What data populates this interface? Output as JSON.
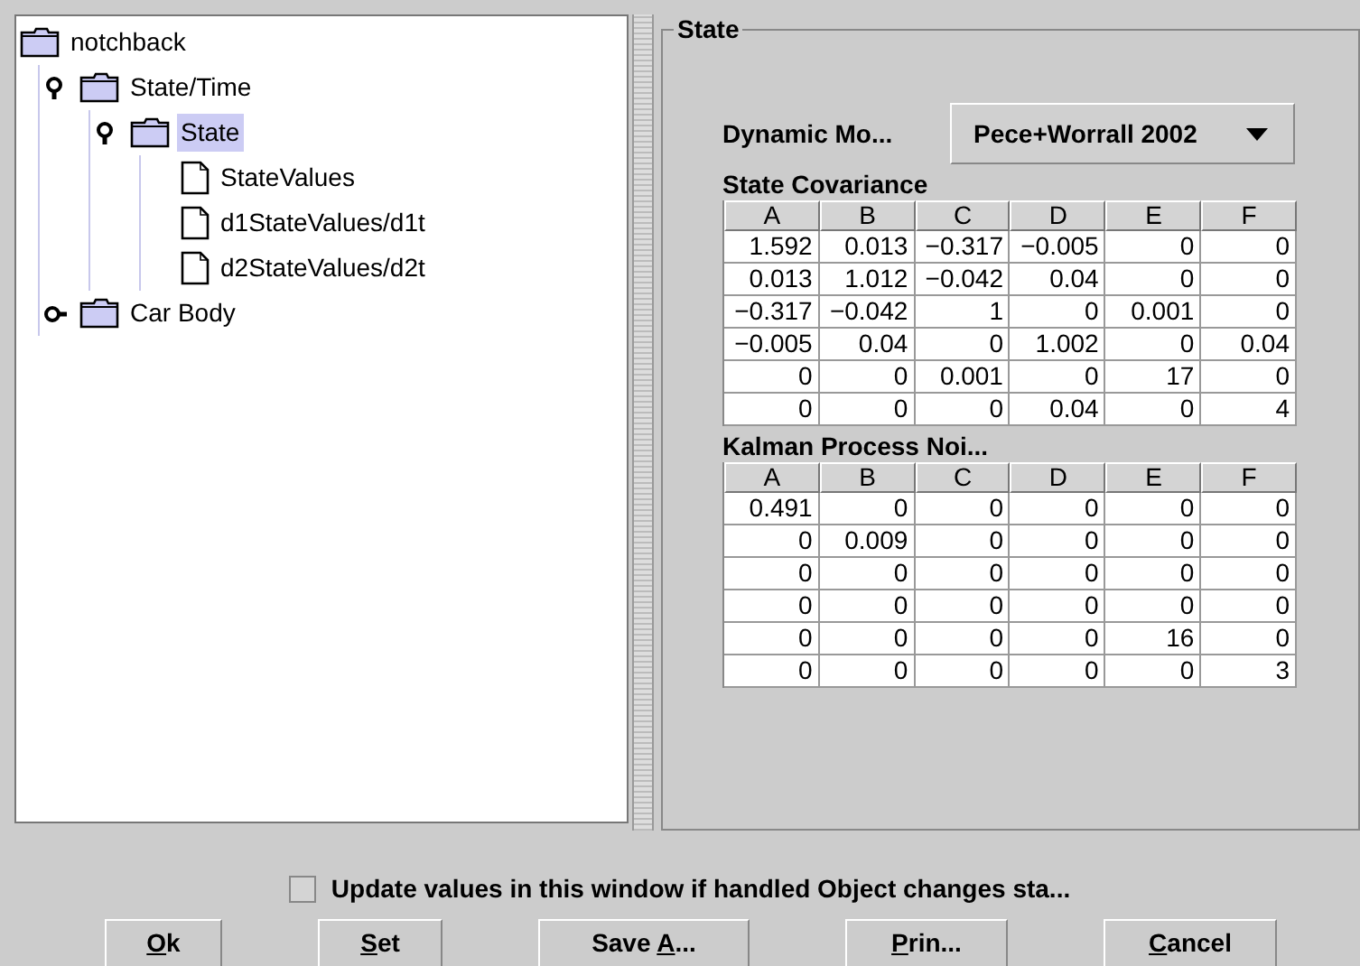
{
  "tree": {
    "root": {
      "label": "notchback",
      "selected": false,
      "children": [
        {
          "kind": "folder",
          "label": "State/Time",
          "expanded": true,
          "selected": false,
          "children": [
            {
              "kind": "folder",
              "label": "State",
              "expanded": true,
              "selected": true,
              "children": [
                {
                  "kind": "file",
                  "label": "StateValues",
                  "selected": false
                },
                {
                  "kind": "file",
                  "label": "d1StateValues/d1t",
                  "selected": false
                },
                {
                  "kind": "file",
                  "label": "d2StateValues/d2t",
                  "selected": false
                }
              ]
            }
          ]
        },
        {
          "kind": "folder",
          "label": "Car Body",
          "expanded": false,
          "selected": false
        }
      ]
    }
  },
  "group": {
    "title": "State",
    "dynamic_model": {
      "label": "Dynamic Mo...",
      "value": "Pece+Worrall 2002"
    },
    "tables": [
      {
        "title": "State Covariance",
        "columns": [
          "A",
          "B",
          "C",
          "D",
          "E",
          "F"
        ],
        "rows": [
          [
            "1.592",
            "0.013",
            "−0.317",
            "−0.005",
            "0",
            "0"
          ],
          [
            "0.013",
            "1.012",
            "−0.042",
            "0.04",
            "0",
            "0"
          ],
          [
            "−0.317",
            "−0.042",
            "1",
            "0",
            "0.001",
            "0"
          ],
          [
            "−0.005",
            "0.04",
            "0",
            "1.002",
            "0",
            "0.04"
          ],
          [
            "0",
            "0",
            "0.001",
            "0",
            "17",
            "0"
          ],
          [
            "0",
            "0",
            "0",
            "0.04",
            "0",
            "4"
          ]
        ]
      },
      {
        "title": "Kalman Process Noi...",
        "columns": [
          "A",
          "B",
          "C",
          "D",
          "E",
          "F"
        ],
        "rows": [
          [
            "0.491",
            "0",
            "0",
            "0",
            "0",
            "0"
          ],
          [
            "0",
            "0.009",
            "0",
            "0",
            "0",
            "0"
          ],
          [
            "0",
            "0",
            "0",
            "0",
            "0",
            "0"
          ],
          [
            "0",
            "0",
            "0",
            "0",
            "0",
            "0"
          ],
          [
            "0",
            "0",
            "0",
            "0",
            "16",
            "0"
          ],
          [
            "0",
            "0",
            "0",
            "0",
            "0",
            "3"
          ]
        ]
      }
    ]
  },
  "update_checkbox": {
    "label": "Update values in this window if handled Object changes sta...",
    "checked": false
  },
  "buttons": [
    {
      "key": "O",
      "after": "k"
    },
    {
      "key": "S",
      "after": "et"
    },
    {
      "before": "Save ",
      "key": "A",
      "after": "..."
    },
    {
      "key": "P",
      "after": "rin..."
    },
    {
      "key": "C",
      "after": "ancel"
    }
  ]
}
